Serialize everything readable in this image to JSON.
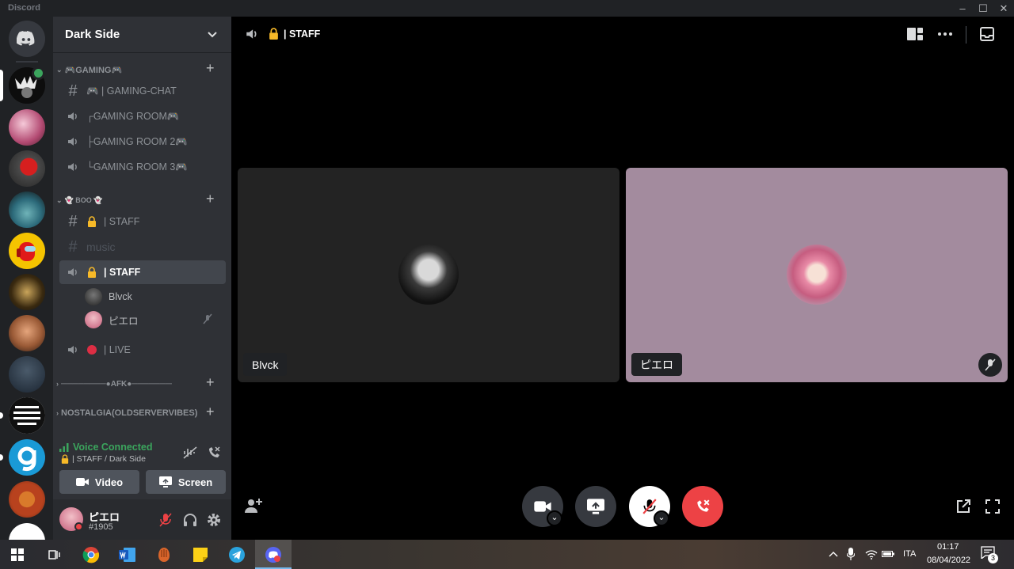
{
  "window": {
    "app_name": "Discord"
  },
  "server": {
    "name": "Dark Side"
  },
  "categories": [
    {
      "label": "🎮GAMING🎮"
    },
    {
      "label": "👻 BOO 👻"
    },
    {
      "label": "────────●AFK●────────"
    },
    {
      "label": "NOSTALGIA(OLDSERVERVIBES)"
    }
  ],
  "channels": {
    "gaming_chat": "🎮 | GAMING-CHAT",
    "gaming_room": "┌GAMING ROOM🎮",
    "gaming_room_2": "├GAMING ROOM 2🎮",
    "gaming_room_3": "└GAMING ROOM 3🎮",
    "staff_text": "| STAFF",
    "music": "music",
    "staff_voice": "| STAFF",
    "live": "| LIVE"
  },
  "voice_members": [
    "Blvck",
    "ピエロ"
  ],
  "voice_panel": {
    "status": "Voice Connected",
    "location": "| STAFF / Dark Side",
    "video_label": "Video",
    "screen_label": "Screen"
  },
  "user": {
    "name": "ピエロ",
    "tag": "#1905"
  },
  "call": {
    "channel_name": "| STAFF",
    "participants": [
      {
        "name": "Blvck",
        "tile_color": "#232323"
      },
      {
        "name": "ピエロ",
        "tile_color": "#a38b9e"
      }
    ]
  },
  "taskbar": {
    "language": "ITA",
    "time": "01:17",
    "date": "08/04/2022",
    "notifications": "3"
  },
  "colors": {
    "blurple": "#5865f2",
    "green": "#3ba55d",
    "red": "#ed4245"
  }
}
